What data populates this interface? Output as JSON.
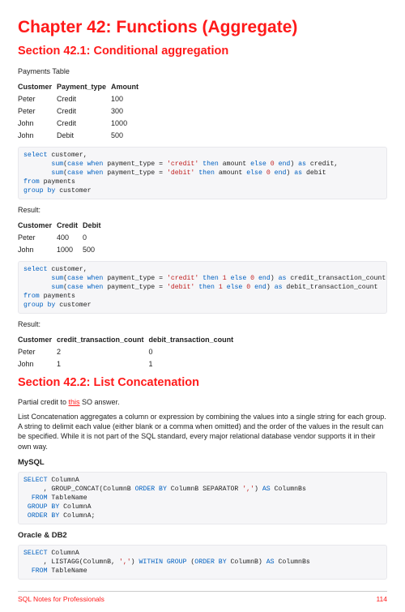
{
  "chapter_title": "Chapter 42: Functions (Aggregate)",
  "section1": {
    "title": "Section 42.1: Conditional aggregation",
    "intro": "Payments Table",
    "table1": {
      "headers": [
        "Customer",
        "Payment_type",
        "Amount"
      ],
      "rows": [
        [
          "Peter",
          "Credit",
          "100"
        ],
        [
          "Peter",
          "Credit",
          "300"
        ],
        [
          "John",
          "Credit",
          "1000"
        ],
        [
          "John",
          "Debit",
          "500"
        ]
      ]
    },
    "result_label": "Result:",
    "table2": {
      "headers": [
        "Customer",
        "Credit",
        "Debit"
      ],
      "rows": [
        [
          "Peter",
          "400",
          "0"
        ],
        [
          "John",
          "1000",
          "500"
        ]
      ]
    },
    "table3": {
      "headers": [
        "Customer",
        "credit_transaction_count",
        "debit_transaction_count"
      ],
      "rows": [
        [
          "Peter",
          "2",
          "0"
        ],
        [
          "John",
          "1",
          "1"
        ]
      ]
    }
  },
  "section2": {
    "title": "Section 42.2: List Concatenation",
    "credit_text_1": "Partial credit to ",
    "credit_link": "this",
    "credit_text_2": " SO answer.",
    "body": "List Concatenation aggregates a column or expression by combining the values into a single string for each group. A string to delimit each value (either blank or a comma when omitted) and the order of the values in the result can be specified. While it is not part of the SQL standard, every major relational database vendor supports it in their own way.",
    "mysql_title": "MySQL",
    "oracle_title": "Oracle & DB2"
  },
  "footer": {
    "left": "SQL Notes for Professionals",
    "right": "114"
  }
}
